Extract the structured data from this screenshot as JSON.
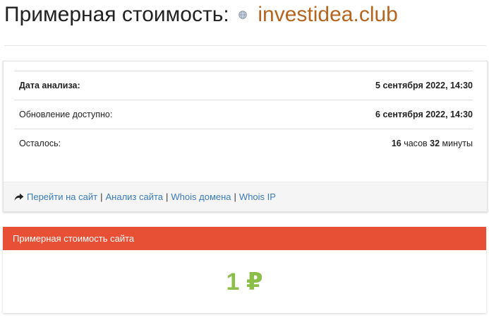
{
  "header": {
    "title_prefix": "Примерная стоимость:",
    "domain": "investidea.club"
  },
  "info": {
    "rows": [
      {
        "label": "Дата анализа:",
        "value": "5 сентября 2022, 14:30"
      },
      {
        "label": "Обновление доступно:",
        "value": "6 сентября 2022, 14:30"
      },
      {
        "label": "Осталось:",
        "hours": "16",
        "hours_unit": "часов",
        "minutes": "32",
        "minutes_unit": "минуты"
      }
    ]
  },
  "links": {
    "goto_site": "Перейти на сайт",
    "analyze_site": "Анализ сайта",
    "whois_domain": "Whois домена",
    "whois_ip": "Whois IP",
    "separator": "|"
  },
  "cost": {
    "header": "Примерная стоимость сайта",
    "value": "1 ₽"
  },
  "colors": {
    "domain": "#b5651d",
    "link": "#3a7bbf",
    "cost_header_bg": "#e85035",
    "cost_value": "#8cbf4a"
  }
}
